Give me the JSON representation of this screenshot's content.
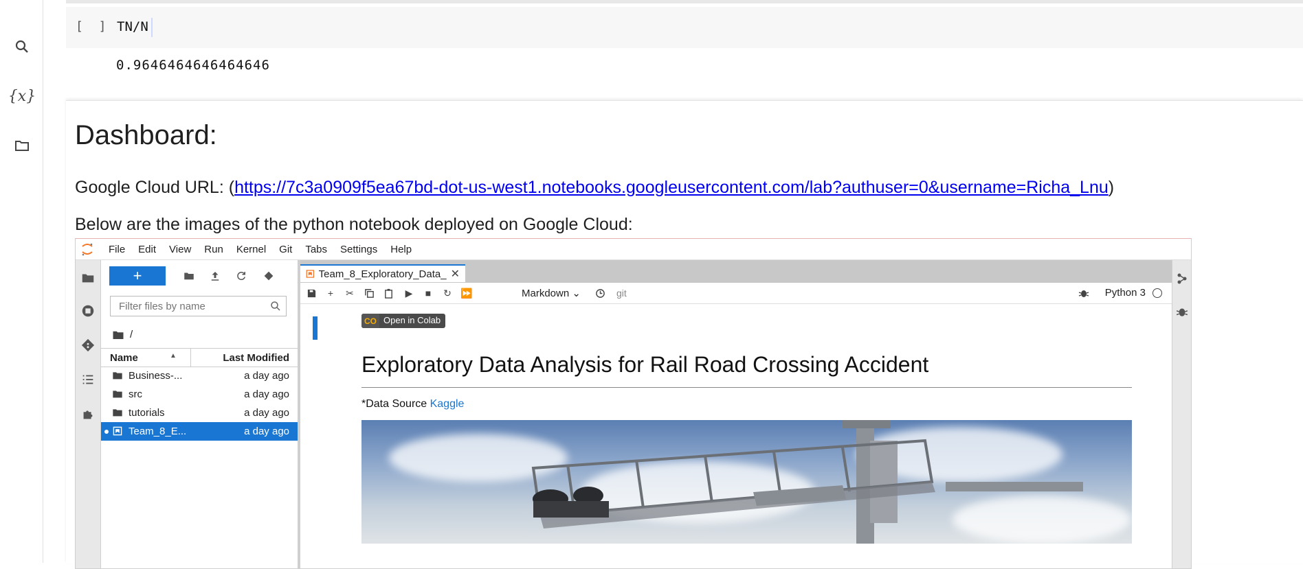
{
  "colab": {
    "code_cell": {
      "prompt": "[ ]",
      "code": "TN/N"
    },
    "output": "0.9646464646464646",
    "markdown": {
      "title": "Dashboard:",
      "url_prefix": "Google Cloud URL: (",
      "url": "https://7c3a0909f5ea67bd-dot-us-west1.notebooks.googleusercontent.com/lab?authuser=0&username=Richa_Lnu",
      "url_suffix": ")",
      "below_text": "Below are the images of the python notebook deployed on Google Cloud:"
    }
  },
  "jupyter": {
    "menu": [
      "File",
      "Edit",
      "View",
      "Run",
      "Kernel",
      "Git",
      "Tabs",
      "Settings",
      "Help"
    ],
    "new_button": "+",
    "filter_placeholder": "Filter files by name",
    "breadcrumb": "/",
    "columns": {
      "name": "Name",
      "modified": "Last Modified"
    },
    "files": [
      {
        "name": "Business-...",
        "modified": "a day ago",
        "type": "folder"
      },
      {
        "name": "src",
        "modified": "a day ago",
        "type": "folder"
      },
      {
        "name": "tutorials",
        "modified": "a day ago",
        "type": "folder"
      },
      {
        "name": "Team_8_E...",
        "modified": "a day ago",
        "type": "notebook",
        "selected": true
      }
    ],
    "tab_title": "Team_8_Exploratory_Data_",
    "cell_type": "Markdown",
    "git_label": "git",
    "kernel": "Python 3",
    "notebook": {
      "badge_logo": "CO",
      "badge_text": "Open in Colab",
      "heading": "Exploratory Data Analysis for Rail Road Crossing Accident",
      "source_prefix": "*Data Source ",
      "source_link": "Kaggle"
    }
  }
}
